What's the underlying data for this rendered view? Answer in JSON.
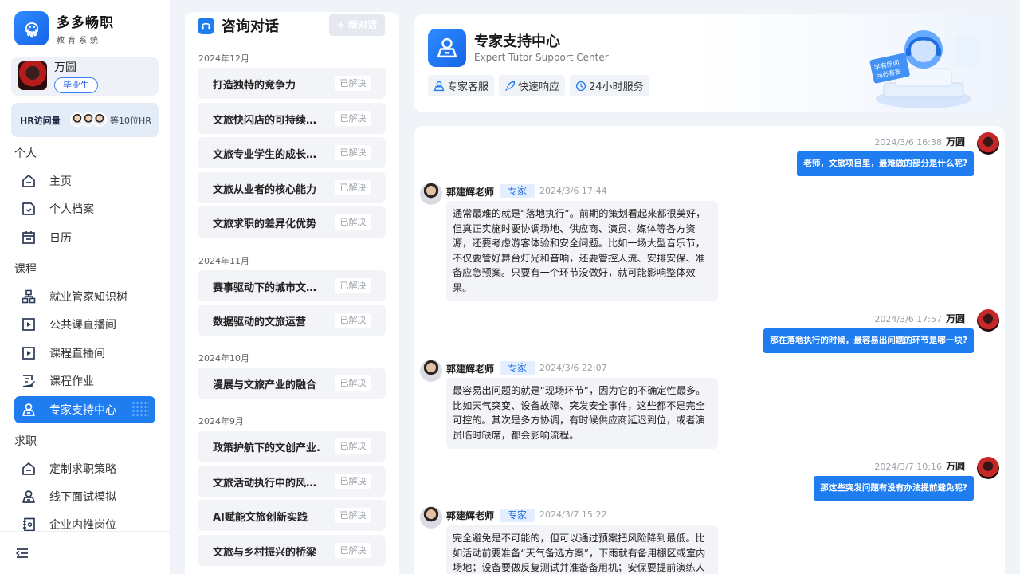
{
  "brand": {
    "name": "多多畅职",
    "subtitle": "教育系统"
  },
  "user": {
    "name": "万圆",
    "badge": "毕业生"
  },
  "hr_visits": {
    "label": "HR访问量",
    "count_text": "等10位HR"
  },
  "nav": {
    "sections": {
      "personal": "个人",
      "course": "课程",
      "job": "求职"
    },
    "personal_items": [
      "主页",
      "个人档案",
      "日历"
    ],
    "course_items": [
      "就业管家知识树",
      "公共课直播间",
      "课程直播间",
      "课程作业",
      "专家支持中心"
    ],
    "job_items": [
      "定制求职策略",
      "线下面试模拟",
      "企业内推岗位"
    ]
  },
  "conversations": {
    "title": "咨询对话",
    "new_button": "+ 新对话",
    "groups": [
      {
        "label": "2024年12月",
        "items": [
          {
            "title": "打造独特的竞争力",
            "status": "已解决"
          },
          {
            "title": "文旅快闪店的可持续挑战",
            "status": "已解决"
          },
          {
            "title": "文旅专业学生的成长方向",
            "status": "已解决"
          },
          {
            "title": "文旅从业者的核心能力",
            "status": "已解决"
          },
          {
            "title": "文旅求职的差异化优势",
            "status": "已解决"
          }
        ]
      },
      {
        "label": "2024年11月",
        "items": [
          {
            "title": "赛事驱动下的城市文旅发展",
            "status": "已解决"
          },
          {
            "title": "数据驱动的文旅运营",
            "status": "已解决"
          }
        ]
      },
      {
        "label": "2024年10月",
        "items": [
          {
            "title": "漫展与文旅产业的融合",
            "status": "已解决"
          }
        ]
      },
      {
        "label": "2024年9月",
        "items": [
          {
            "title": "政策护航下的文创产业.",
            "status": "已解决"
          },
          {
            "title": "文旅活动执行中的风险管理",
            "status": "已解决"
          },
          {
            "title": "AI赋能文旅创新实践",
            "status": "已解决"
          },
          {
            "title": "文旅与乡村振兴的桥梁",
            "status": "已解决"
          }
        ]
      }
    ]
  },
  "header": {
    "title": "专家支持中心",
    "subtitle": "Expert Tutor Support Center",
    "tags": [
      "专家客服",
      "快速响应",
      "24小时服务"
    ],
    "illustration_text": [
      "学有所问",
      "问必有答"
    ]
  },
  "chat": {
    "messages": [
      {
        "from": "me",
        "name": "万圆",
        "time": "2024/3/6 16:38",
        "text": "老师，文旅项目里，最难做的部分是什么呢?"
      },
      {
        "from": "tutor",
        "name": "郭建辉老师",
        "badge": "专家",
        "time": "2024/3/6 17:44",
        "lines": [
          "通常最难的就是“落地执行”。前期的策划看起来都很美好，",
          "但真正实施时要协调场地、供应商、演员、媒体等各方资",
          "源，还要考虑游客体验和安全问题。比如一场大型音乐节，",
          "不仅要管好舞台灯光和音响，还要管控人流、安排安保、准",
          "备应急预案。只要有一个环节没做好，就可能影响整体效",
          "果。"
        ]
      },
      {
        "from": "me",
        "name": "万圆",
        "time": "2024/3/6 17:57",
        "text": "那在落地执行的时候，最容易出问题的环节是哪一块?"
      },
      {
        "from": "tutor",
        "name": "郭建辉老师",
        "badge": "专家",
        "time": "2024/3/6 22:07",
        "lines": [
          "最容易出问题的就是“现场环节”，因为它的不确定性最多。",
          "比如天气突变、设备故障、突发安全事件，这些都不是完全",
          "可控的。其次是多方协调，有时候供应商延迟到位，或者演",
          "员临时缺席，都会影响流程。"
        ]
      },
      {
        "from": "me",
        "name": "万圆",
        "time": "2024/3/7 10:16",
        "text": "那这些突发问题有没有办法提前避免呢?"
      },
      {
        "from": "tutor",
        "name": "郭建辉老师",
        "badge": "专家",
        "time": "2024/3/7 15:22",
        "lines": [
          "完全避免是不可能的，但可以通过预案把风险降到最低。比",
          "如活动前要准备“天气备选方案”，下雨就有备用棚区或室内",
          "场地；设备要做反复测试并准备备用机；安保要提前演练人"
        ]
      }
    ]
  },
  "colors": {
    "primary": "#1f7df0",
    "sidebar_bg": "#ffffff",
    "page_bg": "#f0f3f8"
  }
}
